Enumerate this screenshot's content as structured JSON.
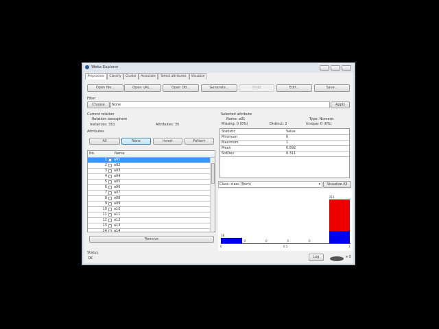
{
  "window": {
    "title": "Weka Explorer"
  },
  "tabs": [
    "Preprocess",
    "Classify",
    "Cluster",
    "Associate",
    "Select attributes",
    "Visualize"
  ],
  "toolbar": [
    "Open file...",
    "Open URL...",
    "Open DB...",
    "Generate...",
    "Undo",
    "Edit...",
    "Save..."
  ],
  "filter": {
    "label": "Filter",
    "choose": "Choose",
    "value": "None",
    "apply": "Apply"
  },
  "relation": {
    "title": "Current relation",
    "relation": "Relation: ionosphere",
    "instances": "Instances: 351",
    "attributes": "Attributes: 35"
  },
  "attributes": {
    "title": "Attributes",
    "buttons": [
      "All",
      "None",
      "Invert",
      "Pattern"
    ],
    "col_no": "No.",
    "col_name": "Name",
    "rows": [
      [
        "1",
        "a01"
      ],
      [
        "2",
        "a02"
      ],
      [
        "3",
        "a03"
      ],
      [
        "4",
        "a04"
      ],
      [
        "5",
        "a05"
      ],
      [
        "6",
        "a06"
      ],
      [
        "7",
        "a07"
      ],
      [
        "8",
        "a08"
      ],
      [
        "9",
        "a09"
      ],
      [
        "10",
        "a10"
      ],
      [
        "11",
        "a11"
      ],
      [
        "12",
        "a12"
      ],
      [
        "13",
        "a13"
      ],
      [
        "14",
        "a14"
      ]
    ],
    "remove": "Remove"
  },
  "selected": {
    "title": "Selected attribute",
    "name": "Name: a01",
    "type": "Type: Numeric",
    "missing": "Missing: 0 (0%)",
    "distinct": "Distinct: 2",
    "unique": "Unique: 0 (0%)",
    "col_stat": "Statistic",
    "col_value": "Value",
    "stats": [
      [
        "Minimum",
        "0"
      ],
      [
        "Maximum",
        "1"
      ],
      [
        "Mean",
        "0.892"
      ],
      [
        "StdDev",
        "0.311"
      ]
    ]
  },
  "class": {
    "value": "Class: class (Nom)",
    "visualize": "Visualize All"
  },
  "histogram": {
    "bins": [
      {
        "label": "38",
        "blue": 38,
        "red": 0
      },
      {
        "label": "0"
      },
      {
        "label": "0"
      },
      {
        "label": "0"
      },
      {
        "label": "0"
      },
      {
        "label": "313",
        "blue": 88,
        "red": 225
      }
    ],
    "axis": [
      "0",
      "0.5",
      "1"
    ],
    "colors": {
      "blue": "#0000ee",
      "red": "#ee0000"
    }
  },
  "status": {
    "title": "Status",
    "text": "OK",
    "log": "Log",
    "count": "x 0"
  }
}
